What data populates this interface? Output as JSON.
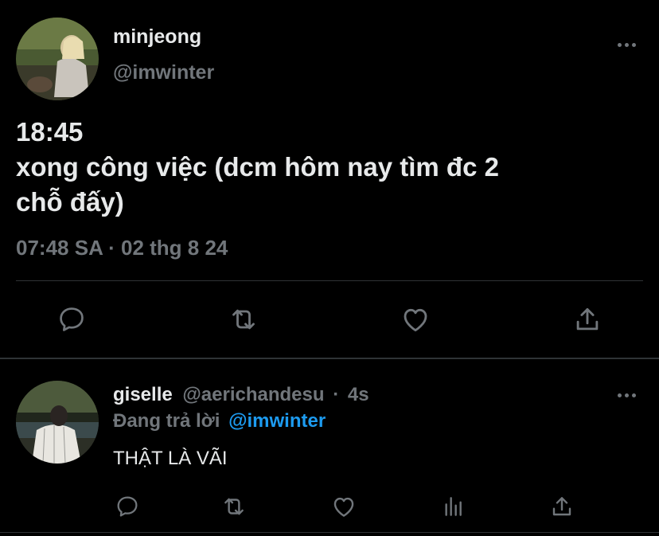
{
  "tweet": {
    "author": {
      "display_name": "minjeong",
      "handle": "@imwinter",
      "avatar": "profile-photo"
    },
    "text_lines": [
      "18:45",
      "xong công việc (dcm hôm nay tìm đc 2",
      "chỗ đấy)"
    ],
    "timestamp": "07:48 SA · 02 thg 8 24",
    "actions": [
      "reply-icon",
      "retweet-icon",
      "like-icon",
      "share-icon"
    ],
    "more_icon": "more-horizontal-icon"
  },
  "reply": {
    "author": {
      "display_name": "giselle",
      "handle": "@aerichandesu",
      "separator": "·",
      "time_ago": "4s",
      "avatar": "profile-photo"
    },
    "replying_prefix": "Đang trả lời",
    "replying_to": "@imwinter",
    "text": "THẬT LÀ VÃI",
    "actions": [
      "reply-icon",
      "retweet-icon",
      "like-icon",
      "analytics-icon",
      "share-icon"
    ],
    "more_icon": "more-horizontal-icon"
  },
  "colors": {
    "background": "#000000",
    "primary_text": "#e7e9ea",
    "secondary_text": "#71767b",
    "divider": "#2f3336",
    "accent": "#1d9bf0"
  }
}
